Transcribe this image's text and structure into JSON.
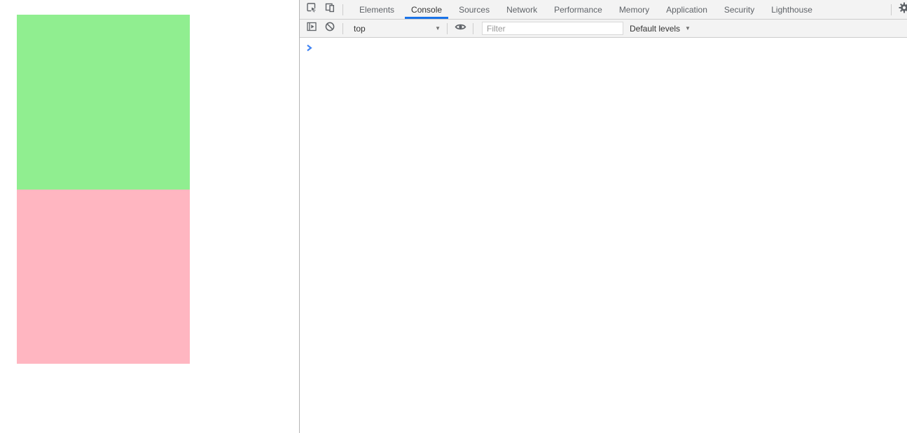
{
  "page": {
    "boxes": [
      {
        "name": "green-box",
        "color": "#90ee90"
      },
      {
        "name": "pink-box",
        "color": "#ffb6c1"
      }
    ]
  },
  "devtools": {
    "tab_bar": {
      "tabs": [
        {
          "label": "Elements"
        },
        {
          "label": "Console"
        },
        {
          "label": "Sources"
        },
        {
          "label": "Network"
        },
        {
          "label": "Performance"
        },
        {
          "label": "Memory"
        },
        {
          "label": "Application"
        },
        {
          "label": "Security"
        },
        {
          "label": "Lighthouse"
        }
      ],
      "active_tab": "Console",
      "accent_color": "#1a73e8"
    },
    "console_toolbar": {
      "context_selector": {
        "value": "top"
      },
      "filter": {
        "placeholder": "Filter",
        "value": ""
      },
      "levels": {
        "label": "Default levels"
      }
    },
    "console": {
      "prompt_symbol": ">",
      "prompt_color": "#4285f4"
    }
  },
  "glyphs": {
    "dropdown_arrow": "▼"
  }
}
